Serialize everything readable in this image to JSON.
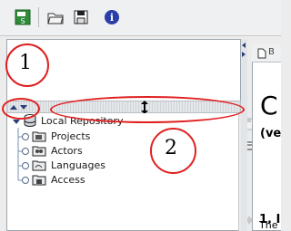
{
  "toolbar": {
    "buttons": [
      {
        "icon": "sql-script-icon"
      },
      {
        "icon": "open-folder-icon"
      },
      {
        "icon": "save-disk-icon"
      },
      {
        "icon": "info-icon"
      }
    ]
  },
  "tree": {
    "root": "Local Repository",
    "children": [
      "Projects",
      "Actors",
      "Languages",
      "Access"
    ]
  },
  "right_panel": {
    "tab_label": "B",
    "big_text": "C",
    "paren_text": "(ve",
    "heading": "1. I",
    "body_text": "The"
  },
  "annotations": [
    "1",
    "2"
  ]
}
